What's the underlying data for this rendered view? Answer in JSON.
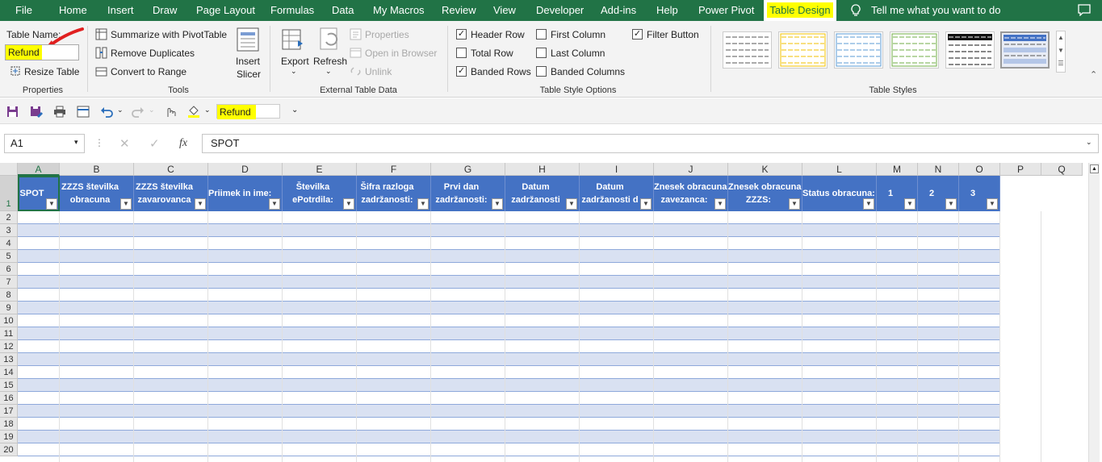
{
  "tabs": [
    "File",
    "Home",
    "Insert",
    "Draw",
    "Page Layout",
    "Formulas",
    "Data",
    "My Macros",
    "Review",
    "View",
    "Developer",
    "Add-ins",
    "Help",
    "Power Pivot",
    "Table Design"
  ],
  "tell_me": "Tell me what you want to do",
  "properties": {
    "table_name_label": "Table Name:",
    "table_name_value": "Refund",
    "resize_table": "Resize Table",
    "group_label": "Properties"
  },
  "tools": {
    "summarize": "Summarize with PivotTable",
    "remove_duplicates": "Remove Duplicates",
    "convert": "Convert to Range",
    "insert_slicer_1": "Insert",
    "insert_slicer_2": "Slicer",
    "group_label": "Tools"
  },
  "external": {
    "export": "Export",
    "refresh": "Refresh",
    "properties": "Properties",
    "open_browser": "Open in Browser",
    "unlink": "Unlink",
    "group_label": "External Table Data"
  },
  "style_options": {
    "header_row": "Header Row",
    "total_row": "Total Row",
    "banded_rows": "Banded Rows",
    "first_column": "First Column",
    "last_column": "Last Column",
    "banded_columns": "Banded Columns",
    "filter_button": "Filter Button",
    "group_label": "Table Style Options",
    "checked": {
      "header_row": true,
      "total_row": false,
      "banded_rows": true,
      "first_column": false,
      "last_column": false,
      "banded_columns": false,
      "filter_button": true
    }
  },
  "table_styles": {
    "group_label": "Table Styles"
  },
  "qat": {
    "table_name": "Refund"
  },
  "formula_bar": {
    "name_box": "A1",
    "fx": "fx",
    "value": "SPOT"
  },
  "columns": [
    "A",
    "B",
    "C",
    "D",
    "E",
    "F",
    "G",
    "H",
    "I",
    "J",
    "K",
    "L",
    "M",
    "N",
    "O",
    "P",
    "Q"
  ],
  "headers": [
    [
      "SPOT"
    ],
    [
      "ZZZS številka",
      "obracuna"
    ],
    [
      "ZZZS številka",
      "zavarovanca"
    ],
    [
      "Priimek in ime:"
    ],
    [
      "Številka",
      "ePotrdila:"
    ],
    [
      "Šifra razloga",
      "zadržanosti:"
    ],
    [
      "Prvi dan",
      "zadržanosti:"
    ],
    [
      "Datum",
      "zadržanosti"
    ],
    [
      "Datum",
      "zadržanosti d"
    ],
    [
      "Znesek obracuna",
      "zavezanca:"
    ],
    [
      "Znesek obracuna",
      "ZZZS:"
    ],
    [
      "Status obracuna:"
    ],
    [
      "1"
    ],
    [
      "2"
    ],
    [
      "3"
    ]
  ],
  "rows": [
    "1",
    "2",
    "3",
    "4",
    "5",
    "6",
    "7",
    "8",
    "9",
    "10",
    "11",
    "12",
    "13",
    "14",
    "15",
    "16",
    "17",
    "18",
    "19",
    "20"
  ],
  "colors": {
    "brand": "#217346",
    "table_header": "#4472c4",
    "band": "#d9e1f2",
    "highlight": "#ffff00"
  }
}
